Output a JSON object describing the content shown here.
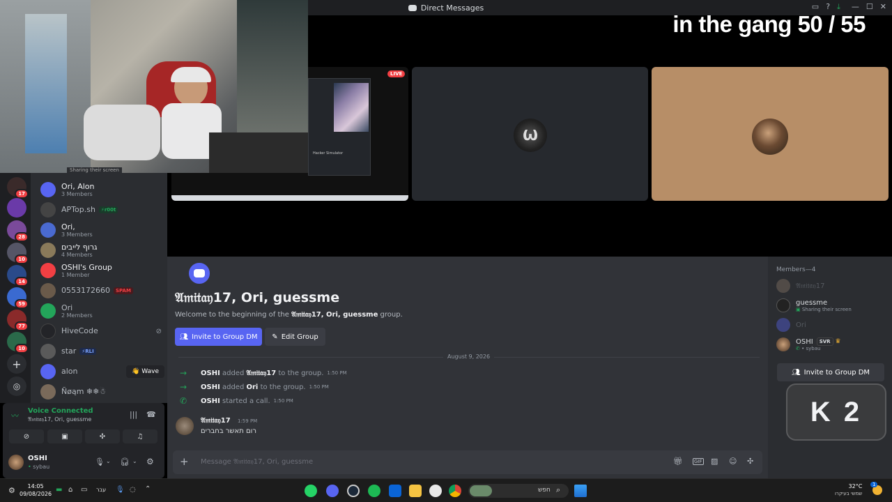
{
  "window": {
    "title": "Direct Messages"
  },
  "stream": {
    "overlay_text": "in the gang 50 / 55",
    "live_badge": "LIVE",
    "k2_text": "K 2",
    "sharing_status": "Sharing their screen",
    "shared_window_caption": "Hacker Simulator"
  },
  "dm_list": [
    {
      "name": "Ori, Alon",
      "sub": "3 Members"
    },
    {
      "name": "APTop.sh",
      "sub": "",
      "tag": "r00t",
      "tag_icon": "bolt-icon"
    },
    {
      "name": "Ori,",
      "sub": "3 Members"
    },
    {
      "name": "גרוף לייבים",
      "sub": "4 Members"
    },
    {
      "name": "OSHI's Group",
      "sub": "1 Member"
    },
    {
      "name": "0553172660",
      "sub": "",
      "tag": "SPAM"
    },
    {
      "name": "Ori",
      "sub": "2 Members"
    },
    {
      "name": "HiveCode",
      "sub": ""
    },
    {
      "name": "star",
      "sub": "",
      "tag": "RLI"
    },
    {
      "name": "alon",
      "sub": "",
      "action": "Wave"
    },
    {
      "name": "Ñøąm ❄❄☃",
      "sub": ""
    }
  ],
  "server_badges": [
    "17",
    "28",
    "10",
    "14",
    "59",
    "77",
    "10"
  ],
  "voice": {
    "status": "Voice Connected",
    "channel": "𝔄𝔪𝔦𝔱𝔞𝔶17, Ori, guessme"
  },
  "user": {
    "name": "OSHI",
    "status": "sybau"
  },
  "chat": {
    "group_title": "𝔄𝔪𝔦𝔱𝔞𝔶17, Ori, guessme",
    "welcome_prefix": "Welcome to the beginning of the",
    "welcome_name": "𝔄𝔪𝔦𝔱𝔞𝔶17, Ori, guessme",
    "welcome_suffix": "group.",
    "invite_button": "Invite to Group DM",
    "edit_button": "Edit Group",
    "date_divider": "August 9, 2026",
    "events": [
      {
        "actor": "OSHI",
        "verb": "added",
        "target": "𝔄𝔪𝔦𝔱𝔞𝔶17",
        "rest": "to the group.",
        "time": "1:50 PM"
      },
      {
        "actor": "OSHI",
        "verb": "added",
        "target": "Ori",
        "rest": "to the group.",
        "time": "1:50 PM"
      },
      {
        "actor": "OSHI",
        "verb": "started a call.",
        "target": "",
        "rest": "",
        "time": "1:50 PM"
      }
    ],
    "message": {
      "author": "𝔄𝔪𝔦𝔱𝔞𝔶17",
      "time": "1:59 PM",
      "text": "רום תאשר בחברים"
    },
    "input_placeholder": "Message 𝔄𝔪𝔦𝔱𝔞𝔶17, Ori, guessme"
  },
  "members": {
    "header": "Members—4",
    "list": [
      {
        "name": "𝔄𝔪𝔦𝔱𝔞𝔶17",
        "sub": ""
      },
      {
        "name": "guessme",
        "sub": "Sharing their screen"
      },
      {
        "name": "Ori",
        "sub": ""
      },
      {
        "name": "OSHI",
        "sub": "sybau",
        "tag": "SVR"
      }
    ],
    "invite_button": "Invite to Group DM"
  },
  "taskbar": {
    "time": "14:05",
    "date": "09/08/2026",
    "lang": "עבר",
    "search_placeholder": "חפש",
    "weather_temp": "32°C",
    "weather_desc": "שמשי בעיקרו",
    "notif_count": "1"
  },
  "colors": {
    "accent": "#5865f2",
    "green": "#23a55a",
    "red": "#f23f43"
  }
}
